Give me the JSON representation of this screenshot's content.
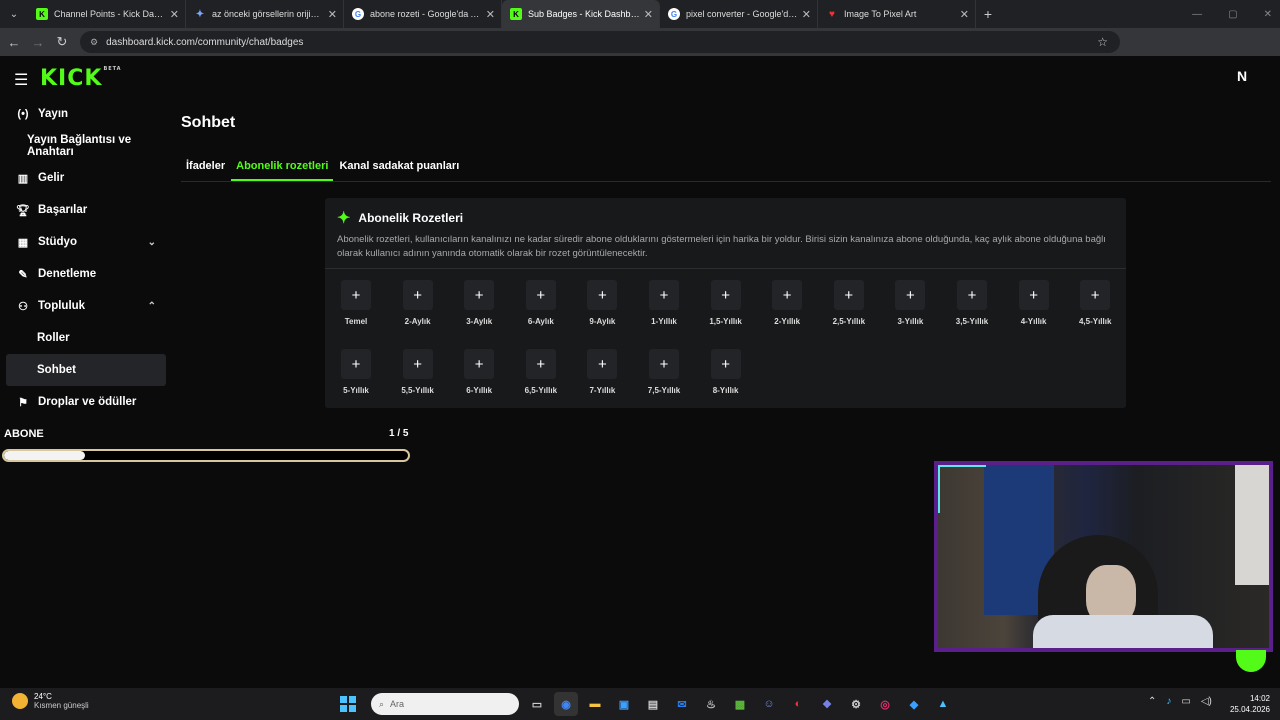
{
  "browser": {
    "tabs": [
      {
        "title": "Channel Points - Kick Dashboard",
        "favicon": "kick-icon",
        "active": false
      },
      {
        "title": "az önceki görsellerin orijinalliğini",
        "favicon": "gemini-icon",
        "active": false
      },
      {
        "title": "abone rozeti - Google'da Ara",
        "favicon": "google-icon",
        "active": false
      },
      {
        "title": "Sub Badges - Kick Dashboard",
        "favicon": "kick-icon",
        "active": true
      },
      {
        "title": "pixel converter - Google'da Ara",
        "favicon": "google-icon",
        "active": false
      },
      {
        "title": "Image To Pixel Art",
        "favicon": "heart-icon",
        "active": false
      }
    ],
    "url": "dashboard.kick.com/community/chat/badges"
  },
  "app": {
    "logo": "KICK",
    "logo_tag": "BETA",
    "user_initial": "N"
  },
  "sidebar": {
    "items": [
      {
        "label": "Yayın",
        "icon": "broadcast-icon",
        "level": 0
      },
      {
        "label": "Yayın Bağlantısı ve Anahtarı",
        "icon": "",
        "level": 1
      },
      {
        "label": "Gelir",
        "icon": "chart-icon",
        "level": 0
      },
      {
        "label": "Başarılar",
        "icon": "trophy-icon",
        "level": 0
      },
      {
        "label": "Stüdyo",
        "icon": "studio-icon",
        "level": 0,
        "chevron": "down"
      },
      {
        "label": "Denetleme",
        "icon": "wrench-icon",
        "level": 0
      },
      {
        "label": "Topluluk",
        "icon": "community-icon",
        "level": 0,
        "chevron": "up"
      },
      {
        "label": "Roller",
        "icon": "",
        "level": 2
      },
      {
        "label": "Sohbet",
        "icon": "",
        "level": 2,
        "active": true
      },
      {
        "label": "Droplar ve ödüller",
        "icon": "drops-icon",
        "level": 0
      }
    ]
  },
  "main": {
    "title": "Sohbet",
    "tabs": [
      {
        "label": "İfadeler",
        "active": false
      },
      {
        "label": "Abonelik rozetleri",
        "active": true
      },
      {
        "label": "Kanal sadakat puanları",
        "active": false
      }
    ],
    "card": {
      "title": "Abonelik Rozetleri",
      "description": "Abonelik rozetleri, kullanıcıların kanalınızı ne kadar süredir abone olduklarını göstermeleri için harika bir yoldur. Birisi sizin kanalınıza abone olduğunda, kaç aylık abone olduğuna bağlı olarak kullanıcı adının yanında otomatik olarak bir rozet görüntülenecektir.",
      "badges": [
        "Temel",
        "2-Aylık",
        "3-Aylık",
        "6-Aylık",
        "9-Aylık",
        "1-Yıllık",
        "1,5-Yıllık",
        "2-Yıllık",
        "2,5-Yıllık",
        "3-Yıllık",
        "3,5-Yıllık",
        "4-Yıllık",
        "4,5-Yıllık",
        "5-Yıllık",
        "5,5-Yıllık",
        "6-Yıllık",
        "6,5-Yıllık",
        "7-Yıllık",
        "7,5-Yıllık",
        "8-Yıllık"
      ],
      "add_symbol": "+"
    }
  },
  "overlay": {
    "goal_label": "ABONE",
    "goal_count": "1 / 5",
    "goal_progress": 0.2
  },
  "taskbar": {
    "temperature": "24°C",
    "weather": "Kısmen güneşli",
    "search_placeholder": "Ara",
    "time": "14:02",
    "date": "25.04.2026"
  },
  "colors": {
    "accent": "#53fc18",
    "card_bg": "#18191b",
    "goal_border": "#d8c79e",
    "webcam_border": "#5a1f8a"
  }
}
